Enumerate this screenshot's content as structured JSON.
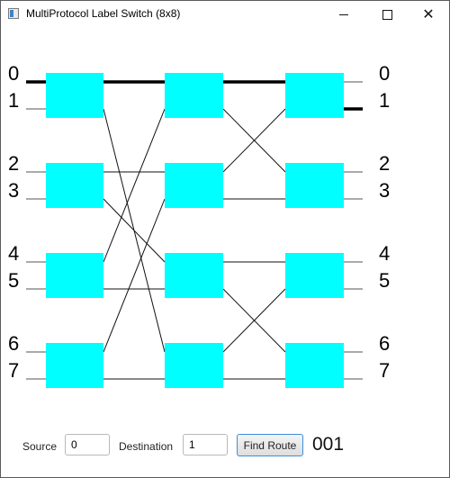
{
  "window": {
    "title": "MultiProtocol Label Switch (8x8)"
  },
  "network": {
    "input_ports": [
      "0",
      "1",
      "2",
      "3",
      "4",
      "5",
      "6",
      "7"
    ],
    "output_ports": [
      "0",
      "1",
      "2",
      "3",
      "4",
      "5",
      "6",
      "7"
    ],
    "switch_color": "#00ffff",
    "active_route_color": "#000000"
  },
  "controls": {
    "source_label": "Source",
    "source_value": "0",
    "destination_label": "Destination",
    "destination_value": "1",
    "find_button": "Find Route",
    "route_result": "001"
  }
}
